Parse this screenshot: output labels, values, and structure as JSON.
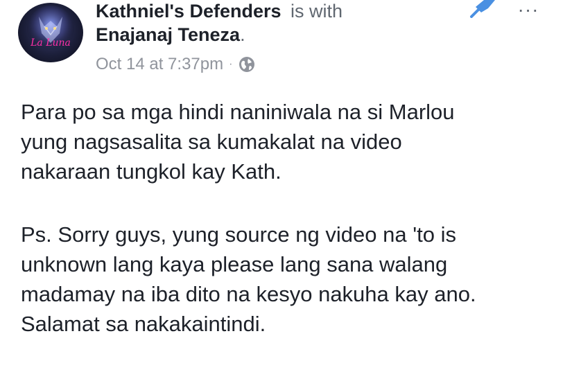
{
  "post": {
    "author": "Kathniel's Defenders",
    "with_text": "is with",
    "tagged": "Enajanaj Teneza",
    "tagged_suffix": ".",
    "timestamp": "Oct 14 at 7:37pm",
    "separator": "·",
    "privacy_icon": "globe-icon",
    "avatar_text": "La Luna",
    "more_label": "···",
    "body": {
      "paragraph1": "Para po sa mga hindi naniniwala na si Marlou\nyung nagsasalita sa kumakalat na video\nnakaraan tungkol kay Kath.",
      "paragraph2": "Ps. Sorry guys, yung source ng video na 'to is\nunknown lang kaya please lang sana walang\nmadamay na iba dito na kesyo nakuha kay ano.\nSalamat sa nakakaintindi."
    }
  },
  "colors": {
    "text": "#1d2129",
    "secondary": "#606770",
    "meta": "#90949c",
    "pin": "#4a90e2"
  }
}
